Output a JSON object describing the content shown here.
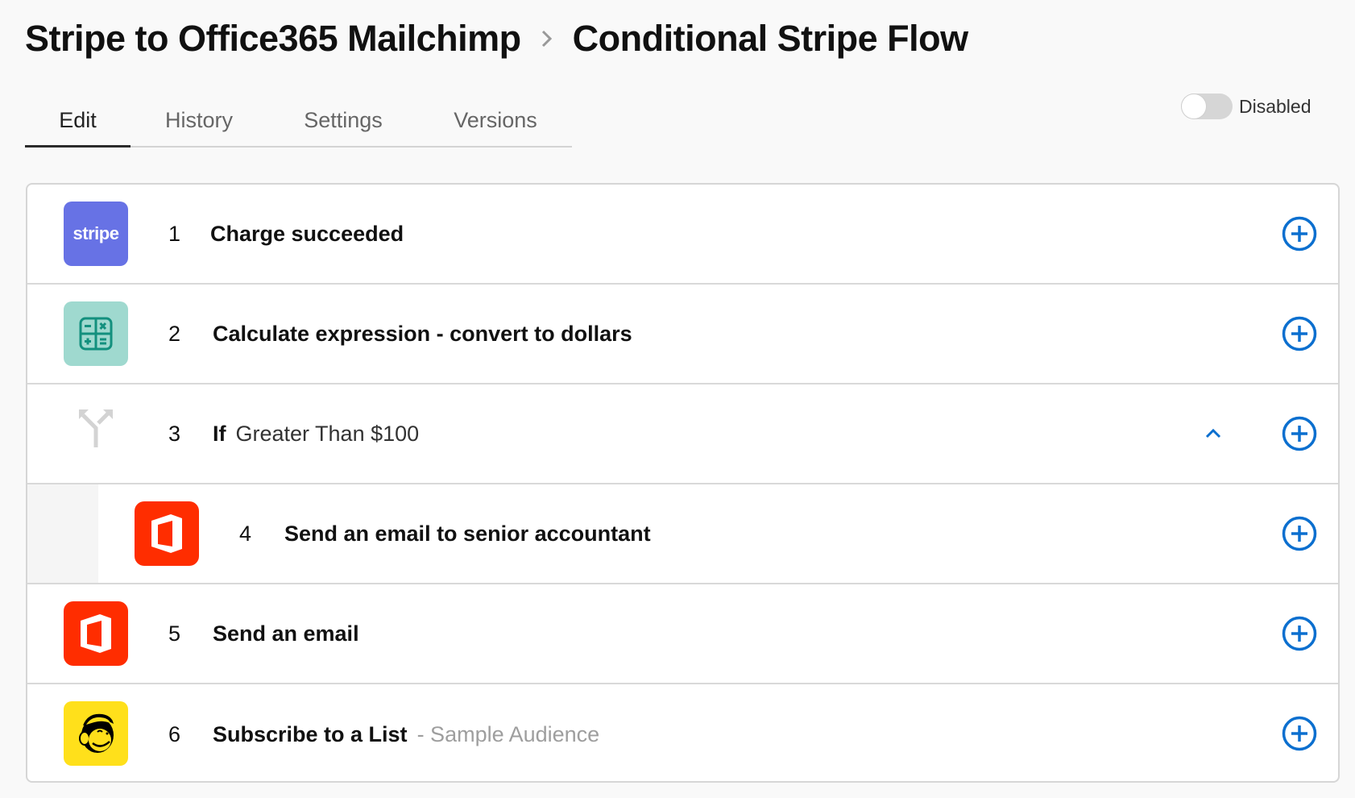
{
  "breadcrumb": {
    "parent": "Stripe to Office365 Mailchimp",
    "separator_icon": "chevron-right-icon",
    "current": "Conditional Stripe Flow"
  },
  "tabs": [
    {
      "label": "Edit",
      "active": true
    },
    {
      "label": "History",
      "active": false
    },
    {
      "label": "Settings",
      "active": false
    },
    {
      "label": "Versions",
      "active": false
    }
  ],
  "status_toggle": {
    "label": "Disabled",
    "enabled": false
  },
  "steps": [
    {
      "number": "1",
      "app": "Stripe",
      "icon": "stripe-logo",
      "icon_text": "stripe",
      "title": "Charge succeeded"
    },
    {
      "number": "2",
      "app": "Calculator",
      "icon": "calculator-icon",
      "title": "Calculate expression - convert to dollars"
    },
    {
      "number": "3",
      "app": "Branch",
      "icon": "branch-icon",
      "title": "If",
      "subtitle": "Greater Than $100",
      "expanded": true
    },
    {
      "number": "4",
      "app": "Office 365",
      "icon": "office365-logo",
      "title": "Send an email to senior accountant",
      "nested": true
    },
    {
      "number": "5",
      "app": "Office 365",
      "icon": "office365-logo",
      "title": "Send an email"
    },
    {
      "number": "6",
      "app": "Mailchimp",
      "icon": "mailchimp-logo",
      "title": "Subscribe to a List",
      "detail": "- Sample Audience"
    }
  ],
  "colors": {
    "accent": "#0b6fcf",
    "stripe": "#6772e5",
    "calculator": "#9fd9cf",
    "office365": "#ff2d00",
    "mailchimp": "#ffe01b"
  }
}
